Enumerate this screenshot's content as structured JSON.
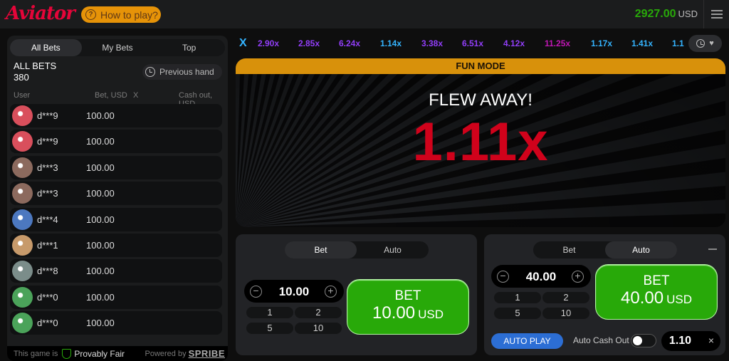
{
  "header": {
    "logo": "Aviator",
    "how_to_play": "How to play?",
    "balance": "2927.00",
    "currency": "USD"
  },
  "left_panel": {
    "tabs": [
      "All Bets",
      "My Bets",
      "Top"
    ],
    "all_bets_label": "ALL BETS",
    "all_bets_count": "380",
    "previous_hand": "Previous hand",
    "columns": {
      "user": "User",
      "bet": "Bet, USD",
      "x": "X",
      "cashout": "Cash out, USD"
    },
    "rows": [
      {
        "user": "d***9",
        "bet": "100.00",
        "avatar": "cat-avatar",
        "color": "#d94f5c"
      },
      {
        "user": "d***9",
        "bet": "100.00",
        "avatar": "cat-avatar",
        "color": "#d94f5c"
      },
      {
        "user": "d***3",
        "bet": "100.00",
        "avatar": "plane-avatar",
        "color": "#8c6a5e"
      },
      {
        "user": "d***3",
        "bet": "100.00",
        "avatar": "plane-avatar",
        "color": "#8c6a5e"
      },
      {
        "user": "d***4",
        "bet": "100.00",
        "avatar": "star-avatar",
        "color": "#4c78c0"
      },
      {
        "user": "d***1",
        "bet": "100.00",
        "avatar": "dog-avatar",
        "color": "#c79a6b"
      },
      {
        "user": "d***8",
        "bet": "100.00",
        "avatar": "plane-avatar",
        "color": "#7b8d8a"
      },
      {
        "user": "d***0",
        "bet": "100.00",
        "avatar": "clover-avatar",
        "color": "#4ba35a"
      },
      {
        "user": "d***0",
        "bet": "100.00",
        "avatar": "clover-avatar",
        "color": "#4ba35a"
      }
    ],
    "footer": {
      "fair_prefix": "This game is",
      "fair": "Provably Fair",
      "powered": "Powered by",
      "brand": "SPRIBE"
    }
  },
  "history": {
    "label": "X",
    "values": [
      {
        "v": "2.90x",
        "color": "#913ef8"
      },
      {
        "v": "2.85x",
        "color": "#913ef8"
      },
      {
        "v": "6.24x",
        "color": "#913ef8"
      },
      {
        "v": "1.14x",
        "color": "#34b4ff"
      },
      {
        "v": "3.38x",
        "color": "#913ef8"
      },
      {
        "v": "6.51x",
        "color": "#913ef8"
      },
      {
        "v": "4.12x",
        "color": "#913ef8"
      },
      {
        "v": "11.25x",
        "color": "#c017b4"
      },
      {
        "v": "1.17x",
        "color": "#34b4ff"
      },
      {
        "v": "1.41x",
        "color": "#34b4ff"
      },
      {
        "v": "1.1",
        "color": "#34b4ff"
      }
    ]
  },
  "game": {
    "mode": "FUN MODE",
    "status": "FLEW AWAY!",
    "multiplier": "1.11x"
  },
  "bet1": {
    "tabs": [
      "Bet",
      "Auto"
    ],
    "active_tab": "Bet",
    "amount": "10.00",
    "quick": [
      "1",
      "2",
      "5",
      "10"
    ],
    "button_label": "BET",
    "button_amount": "10.00",
    "currency": "USD"
  },
  "bet2": {
    "tabs": [
      "Bet",
      "Auto"
    ],
    "active_tab": "Auto",
    "amount": "40.00",
    "quick": [
      "1",
      "2",
      "5",
      "10"
    ],
    "button_label": "BET",
    "button_amount": "40.00",
    "currency": "USD",
    "auto_play": "AUTO PLAY",
    "auto_cash_out": "Auto Cash Out",
    "cash_out_value": "1.10",
    "clear": "×"
  },
  "colors": {
    "accent_red": "#e50539",
    "green": "#28a909",
    "orange": "#d8910b",
    "blue": "#2c6ed4"
  }
}
